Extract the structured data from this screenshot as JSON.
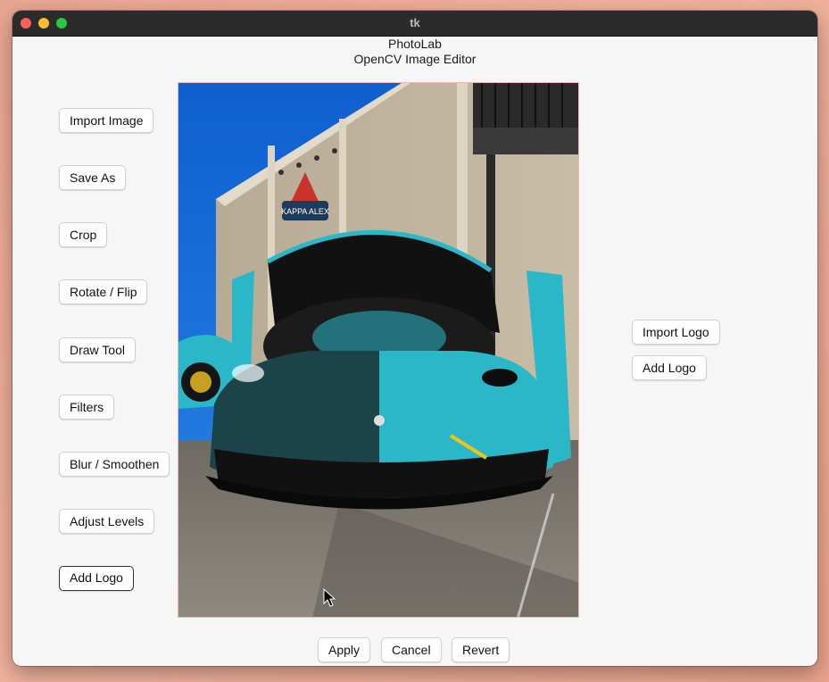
{
  "window": {
    "title": "tk"
  },
  "header": {
    "app_name": "PhotoLab",
    "subtitle": "OpenCV Image Editor"
  },
  "left_toolbar": {
    "items": [
      {
        "label": "Import Image"
      },
      {
        "label": "Save As"
      },
      {
        "label": "Crop"
      },
      {
        "label": "Rotate / Flip"
      },
      {
        "label": "Draw Tool"
      },
      {
        "label": "Filters"
      },
      {
        "label": "Blur / Smoothen"
      },
      {
        "label": "Adjust Levels"
      },
      {
        "label": "Add Logo"
      }
    ]
  },
  "right_panel": {
    "import_logo_label": "Import Logo",
    "add_logo_label": "Add Logo"
  },
  "bottom_bar": {
    "apply_label": "Apply",
    "cancel_label": "Cancel",
    "revert_label": "Revert"
  },
  "image": {
    "sign_text": "KAPPA ALEX",
    "subject": "teal supercar with open hood in front of building"
  },
  "colors": {
    "titlebar": "#2b2b2b",
    "window_bg": "#f6f6f6",
    "button_bg": "#ffffff",
    "car_teal": "#2ab8c8",
    "sky": "#1d6fd8"
  }
}
